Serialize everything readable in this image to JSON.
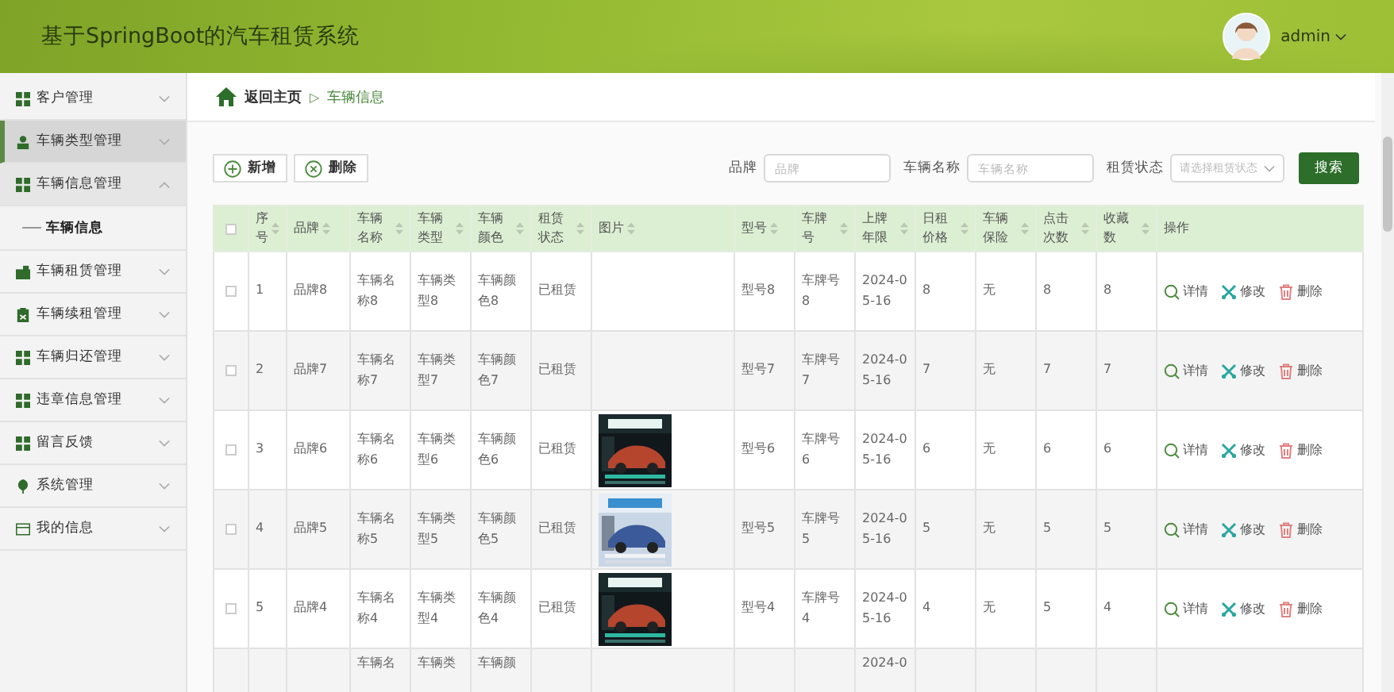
{
  "header": {
    "title": "基于SpringBoot的汽车租赁系统",
    "user": "admin"
  },
  "sidebar": {
    "items": [
      {
        "label": "客户管理",
        "kind": "grid",
        "selected": false,
        "expanded": false
      },
      {
        "label": "车辆类型管理",
        "kind": "person",
        "selected": true,
        "expanded": false
      },
      {
        "label": "车辆信息管理",
        "kind": "grid",
        "selected": false,
        "expanded": true,
        "children": [
          {
            "label": "车辆信息"
          }
        ]
      },
      {
        "label": "车辆租赁管理",
        "kind": "case",
        "selected": false,
        "expanded": false
      },
      {
        "label": "车辆续租管理",
        "kind": "clipboard",
        "selected": false,
        "expanded": false
      },
      {
        "label": "车辆归还管理",
        "kind": "grid",
        "selected": false,
        "expanded": false
      },
      {
        "label": "违章信息管理",
        "kind": "grid",
        "selected": false,
        "expanded": false
      },
      {
        "label": "留言反馈",
        "kind": "grid",
        "selected": false,
        "expanded": false
      },
      {
        "label": "系统管理",
        "kind": "leaf",
        "selected": false,
        "expanded": false
      },
      {
        "label": "我的信息",
        "kind": "card",
        "selected": false,
        "expanded": false
      }
    ]
  },
  "breadcrumb": {
    "home": "返回主页",
    "separator": "▷",
    "current": "车辆信息"
  },
  "toolbar": {
    "buttons": [
      {
        "label": "新增",
        "kind": "add"
      },
      {
        "label": "删除",
        "kind": "remove"
      }
    ],
    "filters": [
      {
        "label": "品牌",
        "placeholder": "品牌",
        "kind": "input"
      },
      {
        "label": "车辆名称",
        "placeholder": "车辆名称",
        "kind": "input"
      },
      {
        "label": "租赁状态",
        "placeholder": "请选择租赁状态",
        "kind": "select"
      }
    ],
    "search": "搜索"
  },
  "table": {
    "all_checked": false,
    "columns": [
      "序号",
      "品牌",
      "车辆名称",
      "车辆类型",
      "车辆颜色",
      "租赁状态",
      "图片",
      "型号",
      "车牌号",
      "上牌年限",
      "日租价格",
      "车辆保险",
      "点击次数",
      "收藏数",
      "操作"
    ],
    "rows": [
      {
        "cells": [
          "1",
          "品牌8",
          "车辆名称8",
          "车辆类型8",
          "车辆颜色8",
          "已租赁",
          "",
          "型号8",
          "车牌号8",
          "2024-05-16",
          "8",
          "无",
          "8",
          "8"
        ],
        "picture": false,
        "checked": false,
        "actions": [
          "详情",
          "修改",
          "删除"
        ]
      },
      {
        "cells": [
          "2",
          "品牌7",
          "车辆名称7",
          "车辆类型7",
          "车辆颜色7",
          "已租赁",
          "",
          "型号7",
          "车牌号7",
          "2024-05-16",
          "7",
          "无",
          "7",
          "7"
        ],
        "picture": false,
        "checked": false,
        "actions": [
          "详情",
          "修改",
          "删除"
        ]
      },
      {
        "cells": [
          "3",
          "品牌6",
          "车辆名称6",
          "车辆类型6",
          "车辆颜色6",
          "已租赁",
          "",
          "型号6",
          "车牌号6",
          "2024-05-16",
          "6",
          "无",
          "6",
          "6"
        ],
        "picture": true,
        "checked": false,
        "actions": [
          "详情",
          "修改",
          "删除"
        ]
      },
      {
        "cells": [
          "4",
          "品牌5",
          "车辆名称5",
          "车辆类型5",
          "车辆颜色5",
          "已租赁",
          "",
          "型号5",
          "车牌号5",
          "2024-05-16",
          "5",
          "无",
          "5",
          "5"
        ],
        "picture": true,
        "checked": false,
        "actions": [
          "详情",
          "修改",
          "删除"
        ]
      },
      {
        "cells": [
          "5",
          "品牌4",
          "车辆名称4",
          "车辆类型4",
          "车辆颜色4",
          "已租赁",
          "",
          "型号4",
          "车牌号4",
          "2024-05-16",
          "4",
          "无",
          "5",
          "4"
        ],
        "picture": true,
        "checked": false,
        "actions": [
          "详情",
          "修改",
          "删除"
        ]
      }
    ],
    "partial_row": {
      "cells": [
        "",
        "",
        "车辆名",
        "车辆类",
        "车辆颜",
        "",
        "",
        "",
        "",
        "2024-0",
        "",
        "",
        "",
        ""
      ]
    }
  }
}
